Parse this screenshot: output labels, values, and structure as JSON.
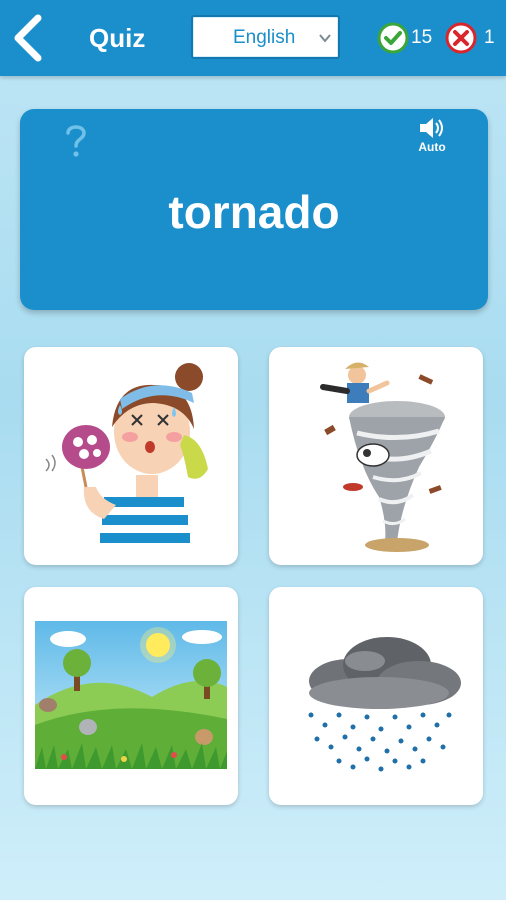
{
  "header": {
    "title": "Quiz",
    "language_selected": "English",
    "correct_count": "15",
    "wrong_count": "1"
  },
  "question": {
    "word": "tornado",
    "audio_label": "Auto"
  },
  "answers": [
    {
      "icon": "hot-girl-fanning-picture"
    },
    {
      "icon": "tornado-picture"
    },
    {
      "icon": "sunny-meadow-picture"
    },
    {
      "icon": "rain-cloud-picture"
    }
  ],
  "colors": {
    "primary": "#1b8fcb",
    "background": "#bfe6f5",
    "correct": "#3aa63a",
    "wrong": "#d9262c"
  }
}
